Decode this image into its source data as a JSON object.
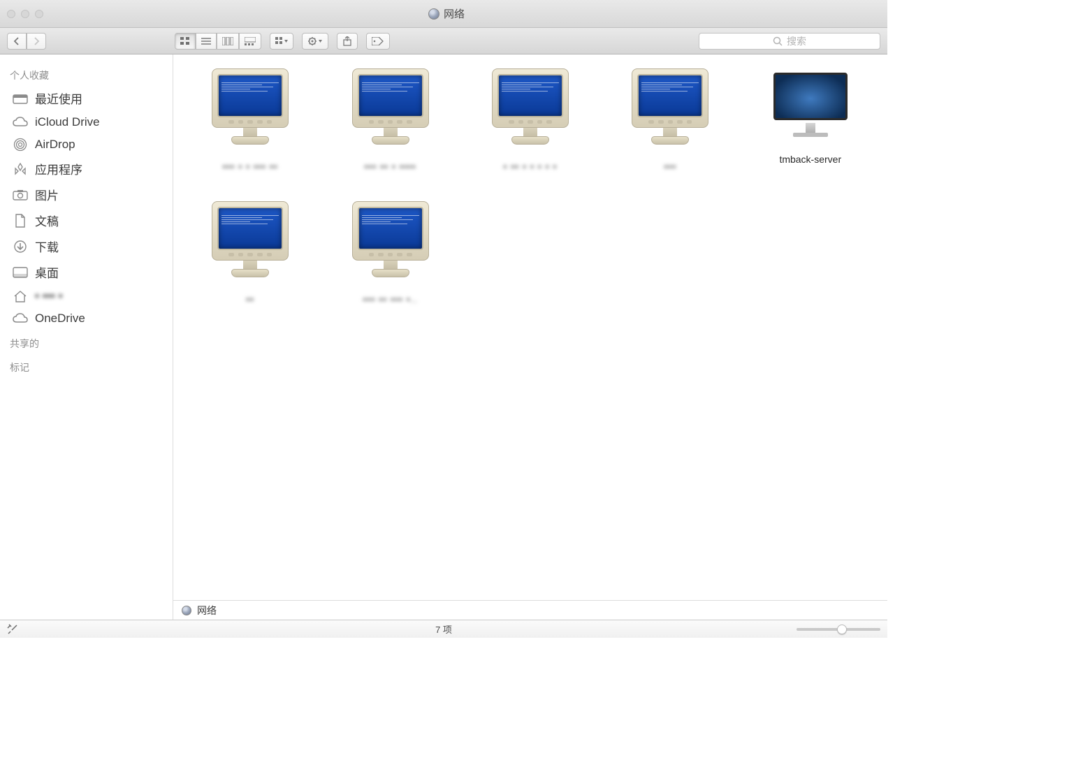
{
  "window": {
    "title": "网络"
  },
  "search": {
    "placeholder": "搜索"
  },
  "sidebar": {
    "sections": {
      "favorites": "个人收藏",
      "shared": "共享的",
      "tags": "标记"
    },
    "items": [
      {
        "label": "最近使用"
      },
      {
        "label": "iCloud Drive"
      },
      {
        "label": "AirDrop"
      },
      {
        "label": "应用程序"
      },
      {
        "label": "图片"
      },
      {
        "label": "文稿"
      },
      {
        "label": "下载"
      },
      {
        "label": "桌面"
      },
      {
        "label": "▪︎ ▪︎▪︎▪︎ ▪︎"
      },
      {
        "label": "OneDrive"
      }
    ]
  },
  "items": [
    {
      "label": "▪︎▪︎▪︎ ▪︎ ▪︎ ▪︎▪︎▪︎ ▪︎▪︎",
      "type": "pc",
      "blurred": true
    },
    {
      "label": "▪︎▪︎▪︎ ▪︎▪︎ ▪︎ ▪︎▪︎▪︎▪︎",
      "type": "pc",
      "blurred": true
    },
    {
      "label": "▪︎ ▪︎▪︎ ▪︎ ▪︎ ▪︎ ▪︎ ▪︎",
      "type": "pc",
      "blurred": true
    },
    {
      "label": "▪︎▪︎▪︎",
      "type": "pc",
      "blurred": true
    },
    {
      "label": "tmback-server",
      "type": "mac",
      "blurred": false
    },
    {
      "label": "▪︎▪︎",
      "type": "pc",
      "blurred": true
    },
    {
      "label": "▪︎▪︎▪︎ ▪︎▪︎ ▪︎▪︎▪︎ ▪︎..",
      "type": "pc",
      "blurred": true
    }
  ],
  "pathbar": {
    "location": "网络"
  },
  "status": {
    "text": "7 项"
  }
}
